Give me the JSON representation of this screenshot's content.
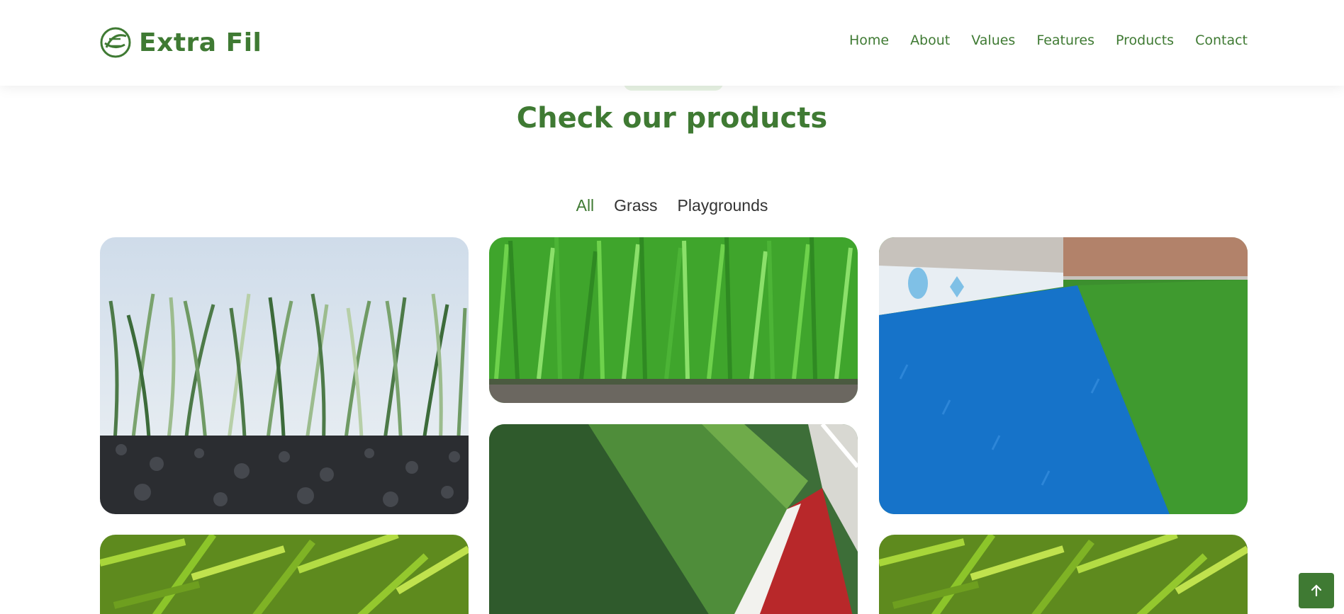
{
  "brand": {
    "name": "Extra Fil",
    "icon": "extra-fil-logo-icon"
  },
  "nav": {
    "items": [
      {
        "label": "Home"
      },
      {
        "label": "About"
      },
      {
        "label": "Values"
      },
      {
        "label": "Features"
      },
      {
        "label": "Products"
      },
      {
        "label": "Contact"
      }
    ]
  },
  "products": {
    "title": "Check our products",
    "filters": [
      {
        "label": "All",
        "active": true
      },
      {
        "label": "Grass",
        "active": false
      },
      {
        "label": "Playgrounds",
        "active": false
      }
    ]
  },
  "back_to_top": {
    "icon": "arrow-up-icon"
  },
  "colors": {
    "accent": "#3f7a33",
    "header_bg": "#ffffff",
    "pill_bg": "#e8f3e4"
  }
}
